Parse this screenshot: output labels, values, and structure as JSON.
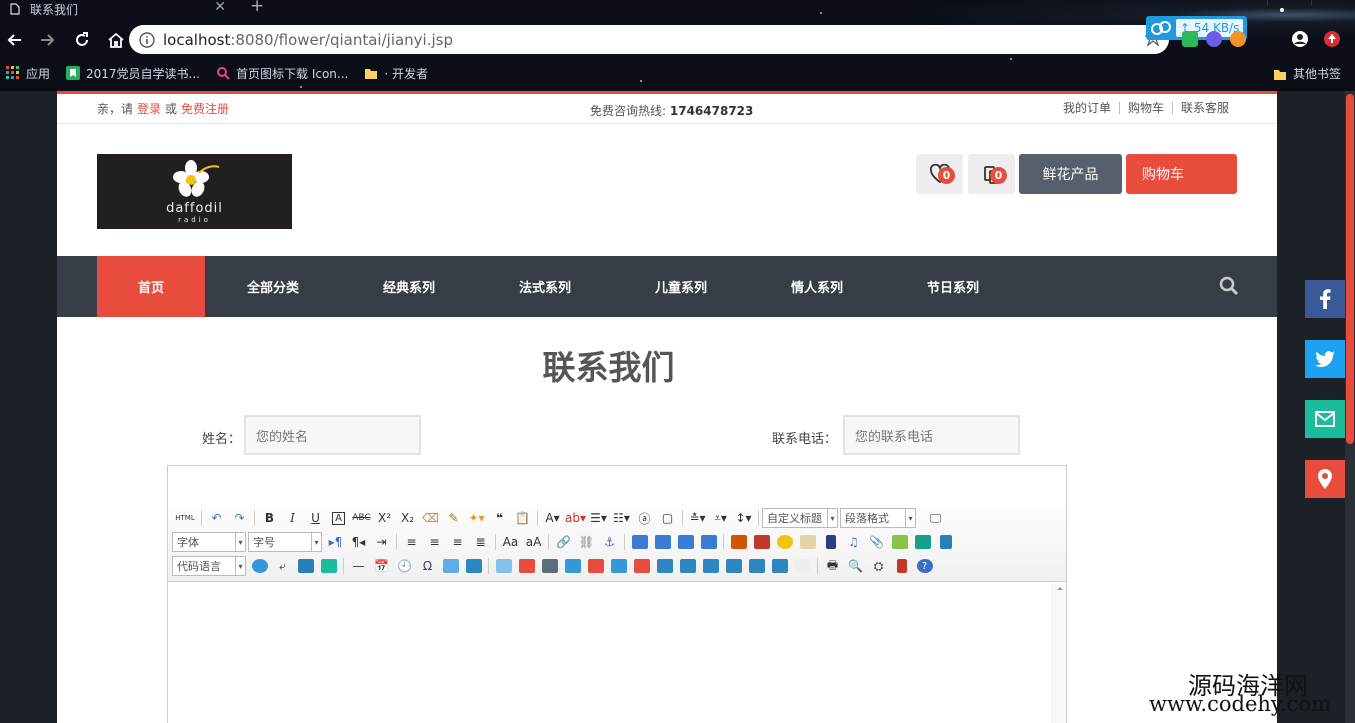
{
  "browser": {
    "tab_title": "联系我们",
    "url_host": "localhost",
    "url_path": ":8080/flower/qiantai/jianyi.jsp",
    "speed": "54 KB/s",
    "bookmarks": [
      {
        "label": "应用",
        "icon": "apps-grid-icon"
      },
      {
        "label": "2017党员自学读书...",
        "icon": "bookmark-green-icon"
      },
      {
        "label": "首页图标下载 Icon...",
        "icon": "search-pink-icon"
      },
      {
        "label": "· 开发者",
        "icon": "folder-icon"
      }
    ],
    "other_bookmarks": "其他书签"
  },
  "topbar": {
    "greet": "亲，请",
    "login": "登录",
    "or": "或",
    "register": "免费注册",
    "hotline_label": "免费咨询热线:",
    "hotline_number": "1746478723",
    "links": [
      "我的订单",
      "购物车",
      "联系客服"
    ]
  },
  "header": {
    "logo_text": "daffodil",
    "logo_sub": "radio",
    "wishlist_count": "0",
    "compare_count": "0",
    "btn_products": "鲜花产品",
    "btn_cart": "购物车"
  },
  "nav": {
    "items": [
      "首页",
      "全部分类",
      "经典系列",
      "法式系列",
      "儿童系列",
      "情人系列",
      "节日系列"
    ]
  },
  "main": {
    "title": "联系我们",
    "name_label": "姓名：",
    "name_placeholder": "您的姓名",
    "phone_label": "联系电话：",
    "phone_placeholder": "您的联系电话"
  },
  "editor": {
    "html_btn": "HTML",
    "custom_title": "自定义标题",
    "paragraph": "段落格式",
    "font": "字体",
    "size": "字号",
    "code_lang": "代码语言"
  },
  "watermark": {
    "line1": "源码海洋网",
    "line2": "www.codehy.com"
  },
  "colors": {
    "accent": "#e74c3c",
    "nav_bg": "#363d47",
    "facebook": "#3b5998",
    "twitter": "#1da1f2",
    "mail": "#1abc9c",
    "location": "#e74c3c"
  }
}
